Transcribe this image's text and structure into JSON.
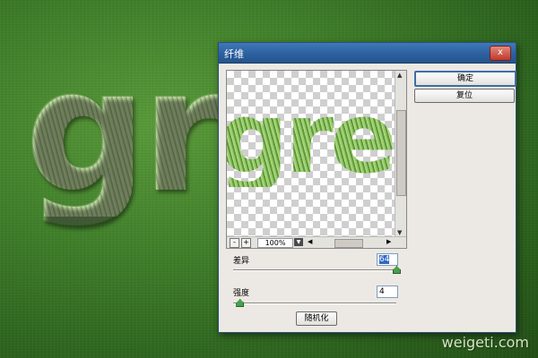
{
  "background": {
    "word": "gre",
    "watermark": "weigeti.com"
  },
  "dialog": {
    "title": "纤维",
    "close_label": "x",
    "preview": {
      "word": "green",
      "zoom": "100%",
      "zoom_out": "-",
      "zoom_in": "+"
    },
    "buttons": {
      "ok": "确定",
      "reset": "复位",
      "randomize": "随机化"
    },
    "variance": {
      "label": "差异",
      "value": "64",
      "slider_fraction": 1.0
    },
    "strength": {
      "label": "强度",
      "value": "4",
      "slider_fraction": 0.04
    }
  },
  "colors": {
    "accent": "#3169c6",
    "titlebar": "#2b5f9d"
  }
}
